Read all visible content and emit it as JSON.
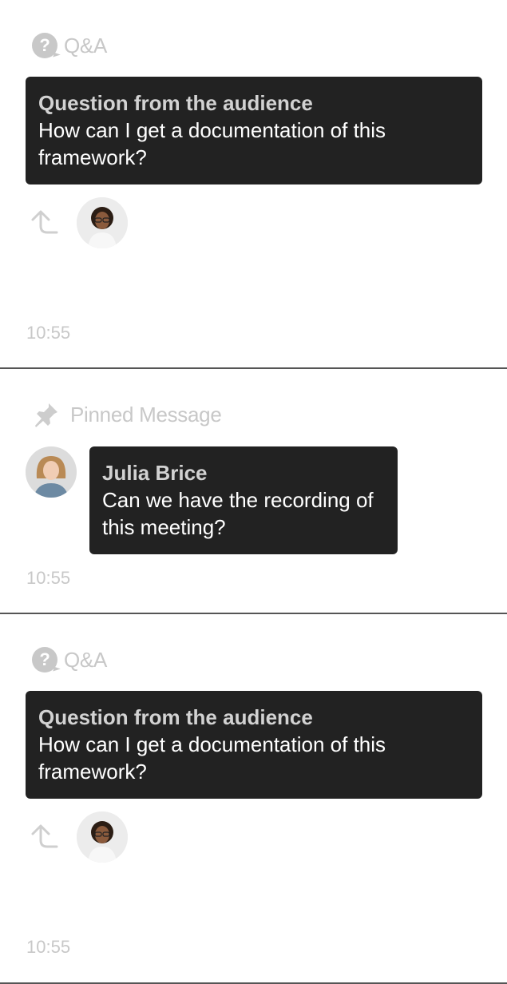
{
  "items": [
    {
      "type": "qa",
      "header_label": "Q&A",
      "bubble_title": "Question from the audience",
      "bubble_text": "How can I get a documentation of this framework?",
      "time": "10:55"
    },
    {
      "type": "pinned",
      "header_label": "Pinned Message",
      "author": "Julia Brice",
      "message": "Can we have the recording of this meeting?",
      "time": "10:55"
    },
    {
      "type": "qa",
      "header_label": "Q&A",
      "bubble_title": "Question from the audience",
      "bubble_text": "How can I get a documentation of this framework?",
      "time": "10:55"
    }
  ],
  "icons": {
    "qa": "question-icon",
    "pinned": "pin-icon",
    "reply": "reply-icon"
  },
  "colors": {
    "bubble_bg": "#222222",
    "muted": "#c8c8c8",
    "divider": "#555555"
  }
}
